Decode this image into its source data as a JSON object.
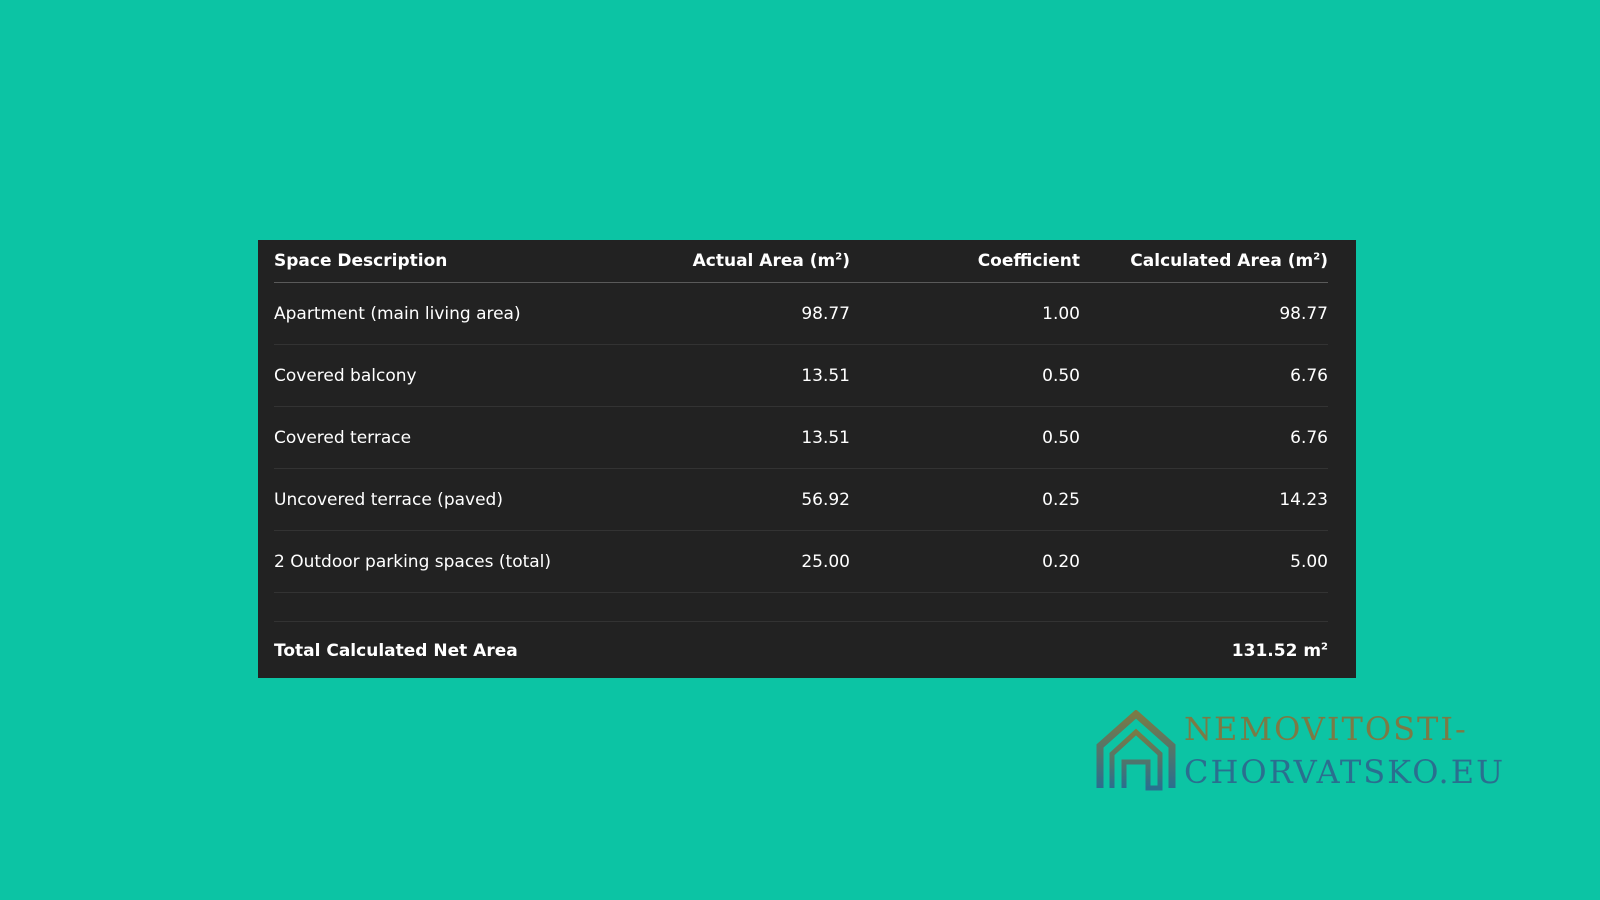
{
  "table": {
    "headers": {
      "description": "Space Description",
      "actual": "Actual Area (m",
      "actual_sup": "2",
      "actual_close": ")",
      "coefficient": "Coefficient",
      "calculated": "Calculated Area (m",
      "calculated_sup": "2",
      "calculated_close": ")"
    },
    "rows": [
      {
        "description": "Apartment (main living area)",
        "actual": "98.77",
        "coefficient": "1.00",
        "calculated": "98.77"
      },
      {
        "description": "Covered balcony",
        "actual": "13.51",
        "coefficient": "0.50",
        "calculated": "6.76"
      },
      {
        "description": "Covered terrace",
        "actual": "13.51",
        "coefficient": "0.50",
        "calculated": "6.76"
      },
      {
        "description": "Uncovered terrace (paved)",
        "actual": "56.92",
        "coefficient": "0.25",
        "calculated": "14.23"
      },
      {
        "description": "2 Outdoor parking spaces (total)",
        "actual": "25.00",
        "coefficient": "0.20",
        "calculated": "5.00"
      }
    ],
    "total": {
      "label": "Total Calculated Net Area",
      "value": "131.52 m",
      "value_sup": "2"
    }
  },
  "brand": {
    "line1": "NEMOVITOSTI-",
    "line2": "CHORVATSKO.EU",
    "icon": "house-icon"
  },
  "colors": {
    "background": "#0cc4a4",
    "table_background": "#222222",
    "brand_line1": "#7b7a45",
    "brand_line2": "#2a6f8f"
  }
}
